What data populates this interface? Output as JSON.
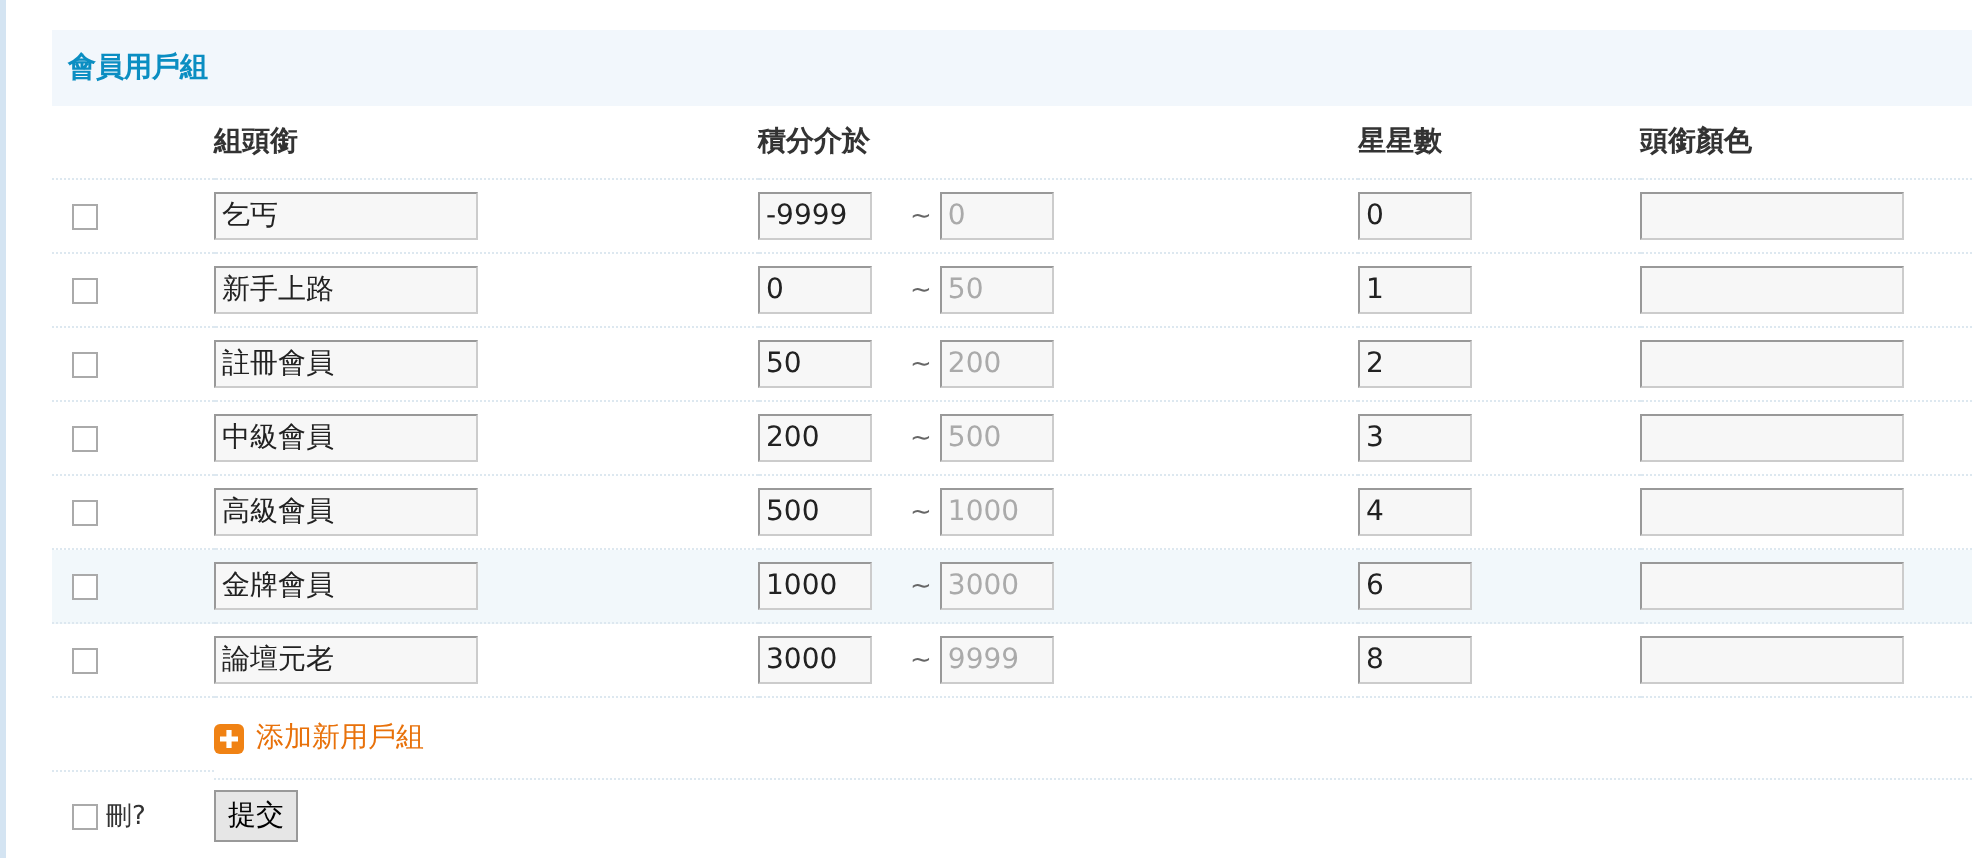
{
  "panel": {
    "title": "會員用戶組"
  },
  "columns": [
    "組頭銜",
    "積分介於",
    "星星數",
    "頭銜顏色"
  ],
  "rows": [
    {
      "checked": false,
      "highlighted": false,
      "name": "乞丐",
      "min": "-9999",
      "separator": "~",
      "max": "0",
      "stars": "0"
    },
    {
      "checked": false,
      "highlighted": false,
      "name": "新手上路",
      "min": "0",
      "separator": "~",
      "max": "50",
      "stars": "1"
    },
    {
      "checked": false,
      "highlighted": false,
      "name": "註冊會員",
      "min": "50",
      "separator": "~",
      "max": "200",
      "stars": "2"
    },
    {
      "checked": false,
      "highlighted": false,
      "name": "中級會員",
      "min": "200",
      "separator": "~",
      "max": "500",
      "stars": "3"
    },
    {
      "checked": false,
      "highlighted": false,
      "name": "高級會員",
      "min": "500",
      "separator": "~",
      "max": "1000",
      "stars": "4"
    },
    {
      "checked": false,
      "highlighted": true,
      "name": "金牌會員",
      "min": "1000",
      "separator": "~",
      "max": "3000",
      "stars": "6"
    },
    {
      "checked": false,
      "highlighted": false,
      "name": "論壇元老",
      "min": "3000",
      "separator": "~",
      "max": "9999",
      "stars": "8"
    }
  ],
  "add_link": {
    "label": "添加新用戶組"
  },
  "footer": {
    "delete_checkbox": {
      "label": "刪?",
      "checked": false
    },
    "submit": "提交"
  }
}
